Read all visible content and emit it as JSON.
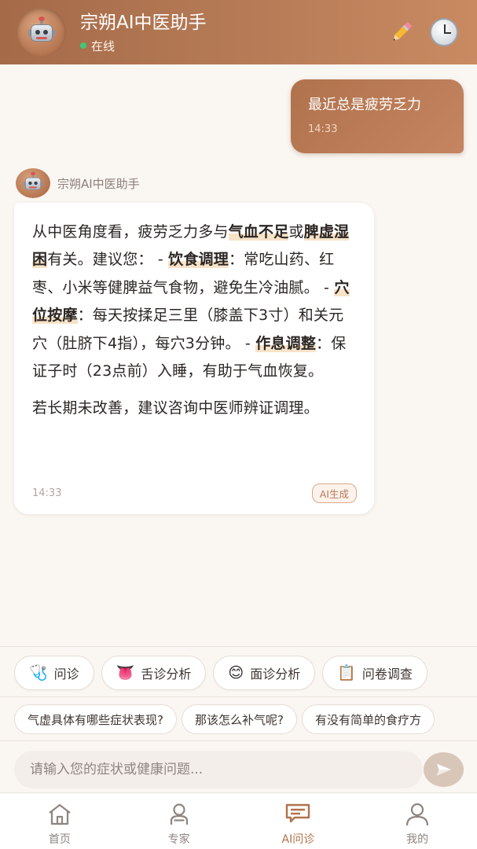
{
  "header": {
    "title": "宗朔AI中医助手",
    "status": "在线",
    "edit_icon": "pencil-icon",
    "history_icon": "clock-icon"
  },
  "messages": {
    "user": {
      "text": "最近总是疲劳乏力",
      "time": "14:33"
    },
    "bot": {
      "name": "宗朔AI中医助手",
      "p1_a": "从中医角度看，疲劳乏力多与",
      "p1_b1": "气血不足",
      "p1_c": "或",
      "p1_b2": "脾虚湿困",
      "p1_d": "有关。建议您： - ",
      "p1_b3": "饮食调理",
      "p1_e": "：常吃山药、红枣、小米等健脾益气食物，避免生冷油腻。 - ",
      "p1_b4": "穴位按摩",
      "p1_f": "：每天按揉足三里（膝盖下3寸）和关元穴（肚脐下4指），每穴3分钟。 - ",
      "p1_b5": "作息调整",
      "p1_g": "：保证子时（23点前）入睡，有助于气血恢复。",
      "p2": "若长期未改善，建议咨询中医师辨证调理。",
      "time": "14:33",
      "badge": "AI生成"
    }
  },
  "tools": [
    {
      "icon": "🩺",
      "label": "问诊"
    },
    {
      "icon": "👅",
      "label": "舌诊分析"
    },
    {
      "icon": "😊",
      "label": "面诊分析"
    },
    {
      "icon": "📋",
      "label": "问卷调查"
    }
  ],
  "suggestions": [
    "气虚具体有哪些症状表现?",
    "那该怎么补气呢?",
    "有没有简单的食疗方"
  ],
  "input": {
    "placeholder": "请输入您的症状或健康问题..."
  },
  "nav": [
    {
      "label": "首页",
      "icon": "home-icon"
    },
    {
      "label": "专家",
      "icon": "expert-icon"
    },
    {
      "label": "AI问诊",
      "icon": "chat-icon"
    },
    {
      "label": "我的",
      "icon": "profile-icon"
    }
  ],
  "colors": {
    "accent": "#b0724c",
    "header_start": "#a56a48",
    "online": "#3ec77a"
  }
}
